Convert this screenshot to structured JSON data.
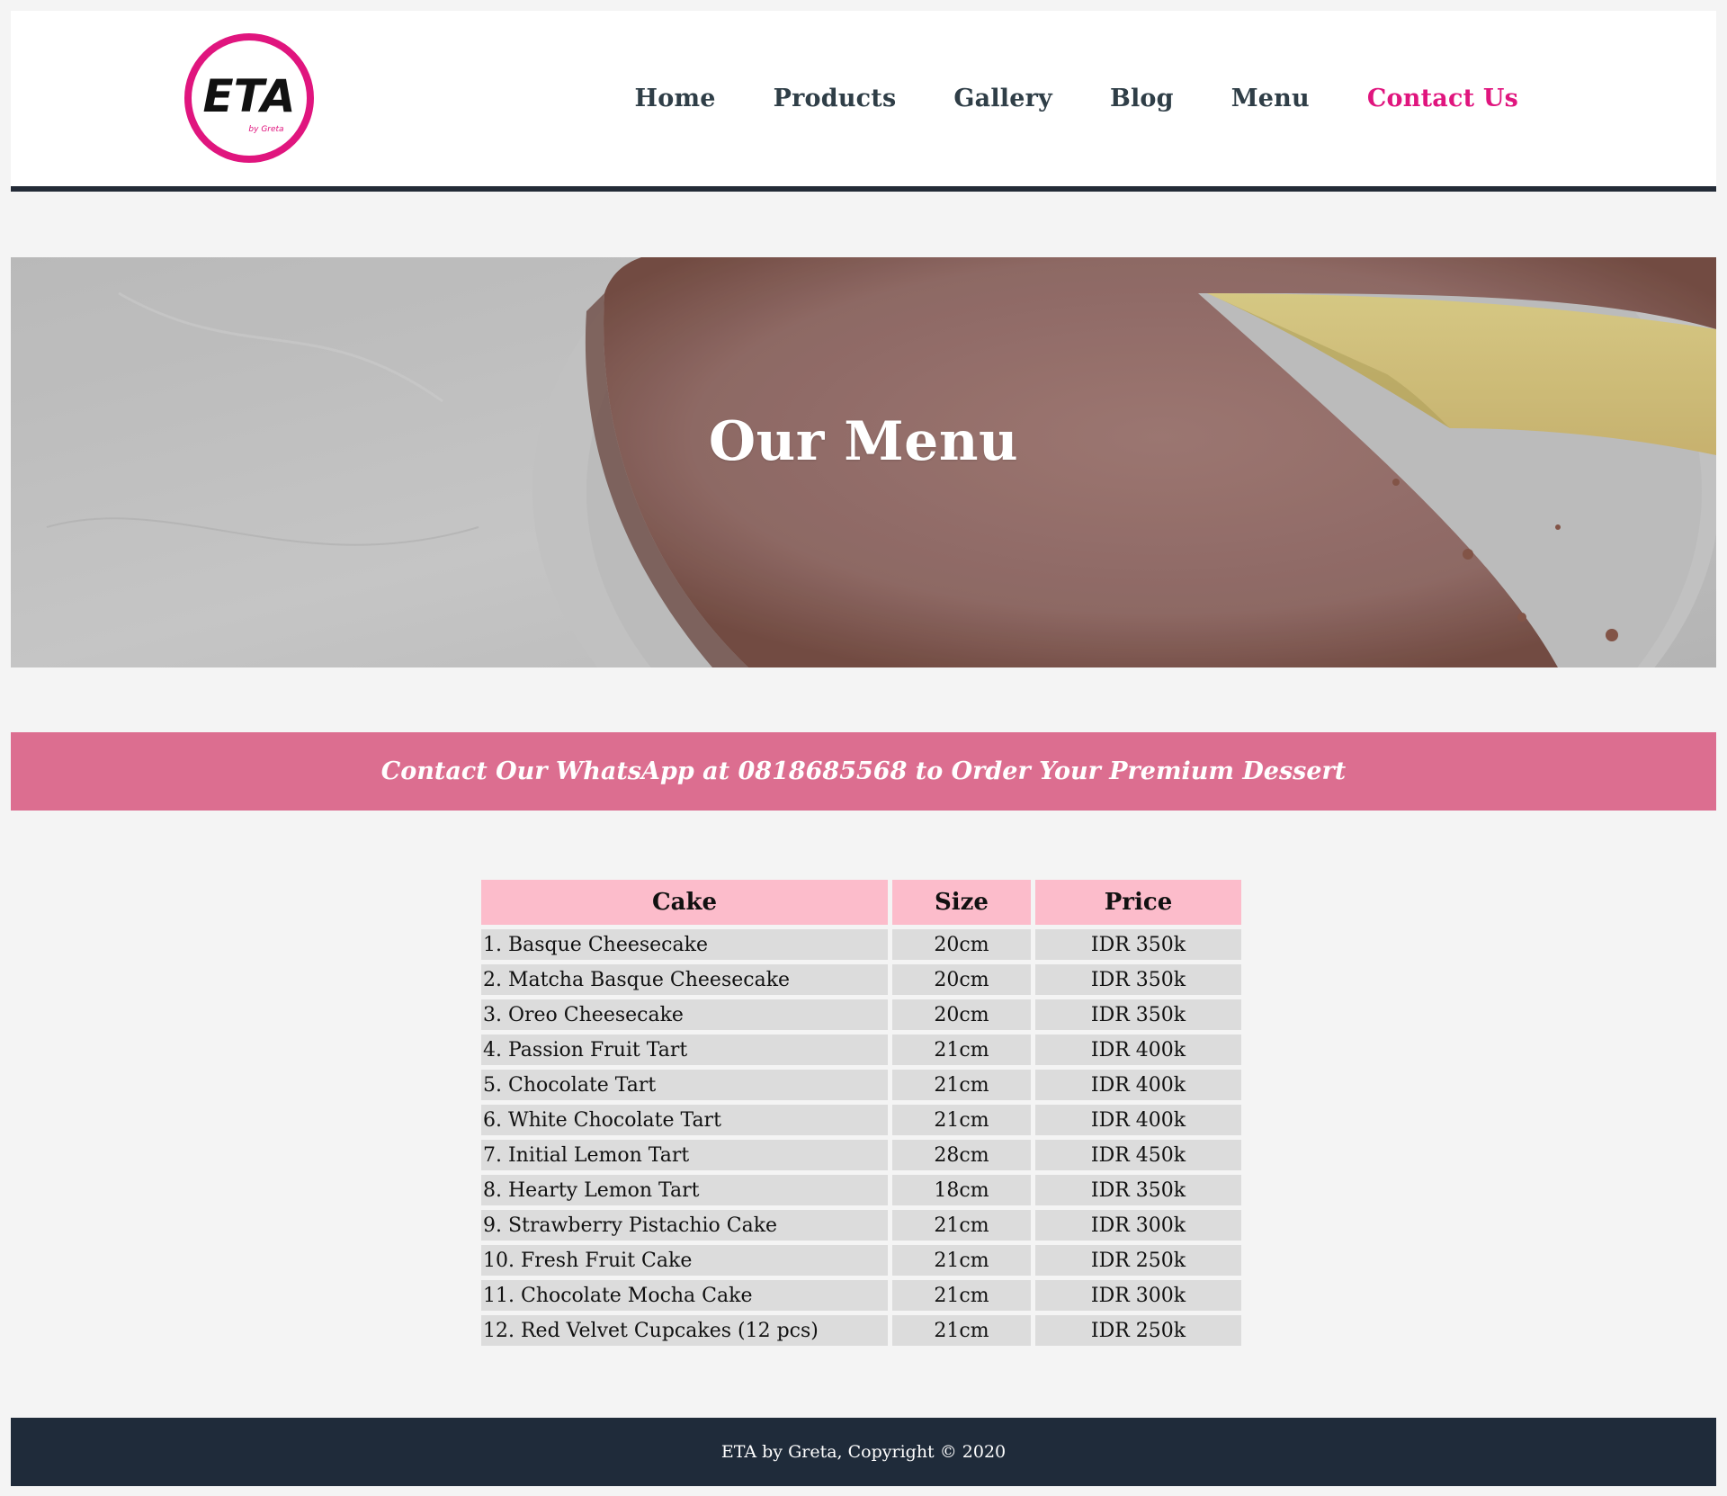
{
  "header": {
    "logo": {
      "text": "ETA",
      "subtext": "by Greta",
      "ring_color": "#e0157e"
    },
    "nav": [
      {
        "label": "Home"
      },
      {
        "label": "Products"
      },
      {
        "label": "Gallery"
      },
      {
        "label": "Blog"
      },
      {
        "label": "Menu"
      },
      {
        "label": "Contact Us",
        "active": true
      }
    ]
  },
  "hero": {
    "title": "Our Menu"
  },
  "banner": {
    "text": "Contact Our WhatsApp at 0818685568 to Order Your Premium Dessert",
    "color": "#dc6e90"
  },
  "menu_table": {
    "headers": [
      "Cake",
      "Size",
      "Price"
    ],
    "rows": [
      [
        "1. Basque Cheesecake",
        "20cm",
        "IDR 350k"
      ],
      [
        "2. Matcha Basque Cheesecake",
        "20cm",
        "IDR 350k"
      ],
      [
        "3. Oreo Cheesecake",
        "20cm",
        "IDR 350k"
      ],
      [
        "4. Passion Fruit Tart",
        "21cm",
        "IDR 400k"
      ],
      [
        "5. Chocolate Tart",
        "21cm",
        "IDR 400k"
      ],
      [
        "6. White Chocolate Tart",
        "21cm",
        "IDR 400k"
      ],
      [
        "7. Initial Lemon Tart",
        "28cm",
        "IDR 450k"
      ],
      [
        "8. Hearty Lemon Tart",
        "18cm",
        "IDR 350k"
      ],
      [
        "9. Strawberry Pistachio Cake",
        "21cm",
        "IDR 300k"
      ],
      [
        "10. Fresh Fruit Cake",
        "21cm",
        "IDR 250k"
      ],
      [
        "11. Chocolate Mocha Cake",
        "21cm",
        "IDR 300k"
      ],
      [
        "12. Red Velvet Cupcakes (12 pcs)",
        "21cm",
        "IDR 250k"
      ]
    ],
    "header_color": "#fcbccb",
    "cell_color": "#dcdcdc"
  },
  "footer": {
    "text": "ETA by Greta, Copyright © 2020",
    "color": "#1f2b3a"
  }
}
